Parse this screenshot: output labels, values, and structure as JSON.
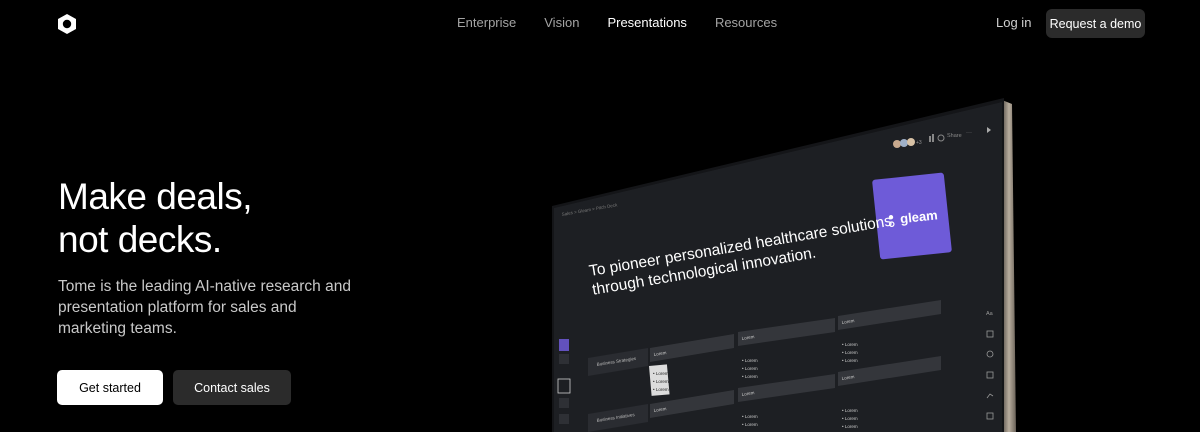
{
  "nav": {
    "links": [
      "Enterprise",
      "Vision",
      "Presentations",
      "Resources"
    ],
    "active": "Presentations",
    "login": "Log in",
    "demo": "Request a demo"
  },
  "hero": {
    "title_line1": "Make deals,",
    "title_line2": "not decks.",
    "subtitle": "Tome is the leading AI-native research and presentation platform for sales and marketing teams.",
    "cta_primary": "Get started",
    "cta_secondary": "Contact sales"
  },
  "mockup": {
    "toolbar_share": "Share",
    "avatar_count": "+3",
    "breadcrumb": "Sales > Gleam > Pitch Deck",
    "logo_text": "gleam",
    "headline_line1": "To pioneer personalized healthcare solutions",
    "headline_line2": "through technological innovation.",
    "row1_label": "Business Strategies",
    "row2_label": "Business Initiatives",
    "cell_header": "Lorem",
    "bullet": "Lorem",
    "sidebar_icon_text": "Aa",
    "colors": {
      "accent": "#6e5bd8",
      "panel": "#1f2125",
      "cell": "#34363b"
    }
  }
}
